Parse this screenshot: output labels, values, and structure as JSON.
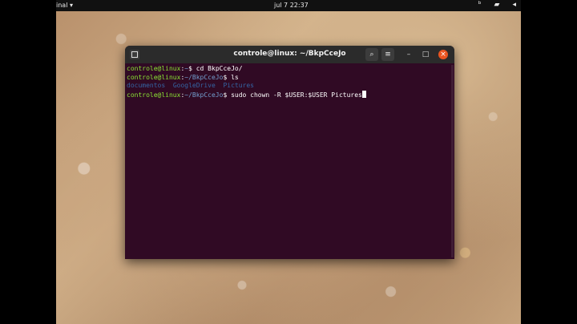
{
  "topbar": {
    "app_label": "inal ▾",
    "clock": "jul 7  22:37",
    "tray_icons": [
      "bing-icon",
      "network-icon",
      "volume-icon"
    ]
  },
  "window": {
    "title": "controle@linux: ~/BkpCceJo",
    "buttons": {
      "search": "search-icon",
      "menu": "hamburger-menu-icon",
      "minimize": "–",
      "maximize": "□",
      "close": "×"
    }
  },
  "terminal": {
    "lines": [
      {
        "user": "controle@linux",
        "sep": ":",
        "path": "~",
        "prompt": "$ ",
        "cmd": "cd BkpCceJo/"
      },
      {
        "user": "controle@linux",
        "sep": ":",
        "path": "~/BkpCceJo",
        "prompt": "$ ",
        "cmd": "ls"
      },
      {
        "output": [
          "documentos",
          "GoogleDrive",
          "Pictures"
        ]
      },
      {
        "user": "controle@linux",
        "sep": ":",
        "path": "~/BkpCceJo",
        "prompt": "$ ",
        "cmd": "sudo chown -R $USER:$USER Pictures"
      }
    ]
  },
  "colors": {
    "terminal_bg": "#300a24",
    "user": "#8ae234",
    "path": "#729fcf",
    "close_button": "#e95420"
  }
}
